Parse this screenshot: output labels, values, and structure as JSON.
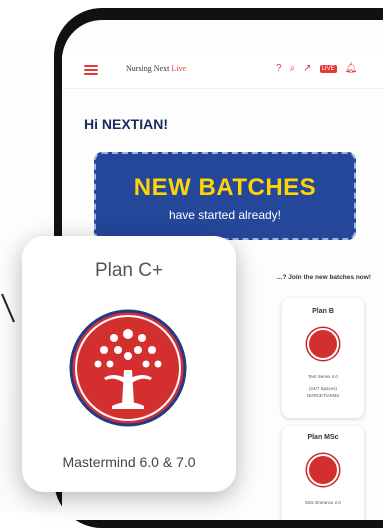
{
  "app": {
    "brand_prefix": "Nursing Next ",
    "brand_suffix": "Live"
  },
  "greeting": "Hi NEXTIAN!",
  "banner": {
    "title": "NEW BATCHES",
    "subtitle": "have started already!"
  },
  "join_text": "…? Join the new batches now!",
  "featured_plan": {
    "name": "Plan C+",
    "footer": "Mastermind 6.0 & 7.0"
  },
  "cards": [
    {
      "title": "Plan B",
      "sub1": "Test Series 4.0",
      "sub2": "(24/7 Spaces)",
      "sub3": "NORCET/AIIMS"
    },
    {
      "title": "Plan MSc",
      "sub1": "MSc Entrance 2.0"
    }
  ],
  "colors": {
    "accent": "#e53935",
    "banner_bg": "#25479a",
    "banner_title": "#ffd400",
    "greet": "#1a2a5e"
  },
  "icons": [
    "menu-icon",
    "help-icon",
    "search-icon",
    "share-icon",
    "live-badge-icon",
    "bell-icon"
  ],
  "topbar_badge": "LIVE"
}
